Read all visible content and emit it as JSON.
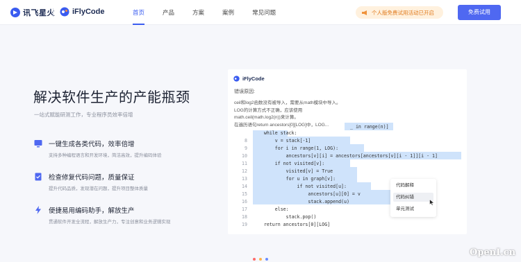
{
  "header": {
    "brand_name": "讯飞星火",
    "product_name": "iFlyCode",
    "nav": [
      "首页",
      "产品",
      "方案",
      "案例",
      "常见问题"
    ],
    "active_nav": "首页",
    "promo_text": "个人版免费试用活动已开启",
    "trial_button": "免费试用",
    "brand_color": "#4f68f1"
  },
  "hero": {
    "title": "解决软件生产的产能瓶颈",
    "subtitle": "一站式赋能研测工作，专业程序员效率倍增",
    "features": [
      {
        "icon": "monitor-icon",
        "title": "一键生成各类代码，效率倍增",
        "desc": "支持多种编程语言和开发环境，简洁高效，提升编码体验"
      },
      {
        "icon": "document-check-icon",
        "title": "检查修复代码问题，质量保证",
        "desc": "提升代码品质，发现潜在问题，提升项目整体质量"
      },
      {
        "icon": "lightning-icon",
        "title": "便捷易用编码助手，解放生产",
        "desc": "贯通软件开发全流程，解放生产力，专注创意和业务逻辑实现"
      }
    ]
  },
  "panel": {
    "brand": "iFlyCode",
    "error_title": "错误原因:",
    "error_lines": [
      "ceil和log2函数没有被导入，需要从math模块中导入。",
      "LOG的计算方式不正确，应该使用",
      "math.ceil(math.log2(n))来计算。",
      "在遍历语句return ancestors[0][LOG]中，LOG..."
    ],
    "hidden_fragment": "_ in range(n)]",
    "code_lines": [
      {
        "n": "",
        "text": "    while stack:"
      },
      {
        "n": "8",
        "text": "        v = stack[-1]"
      },
      {
        "n": "9",
        "text": "        for i in range(1, LOG):"
      },
      {
        "n": "10",
        "text": "            ancestors[v][i] = ancestors[ancestors[v][i - 1]][i - 1]"
      },
      {
        "n": "11",
        "text": "        if not visited[v]:"
      },
      {
        "n": "12",
        "text": "            visited[v] = True"
      },
      {
        "n": "13",
        "text": "            for u in graph[v]:"
      },
      {
        "n": "14",
        "text": "                if not visited[u]:"
      },
      {
        "n": "15",
        "text": "                    ancestors[u][0] = v"
      },
      {
        "n": "16",
        "text": "                    stack.append(u)"
      },
      {
        "n": "17",
        "text": "        else:"
      },
      {
        "n": "18",
        "text": "            stack.pop()"
      },
      {
        "n": "19",
        "text": "    return ancestors[0][LOG]"
      }
    ],
    "context_menu": [
      "代码解释",
      "代码纠错",
      "单元测试"
    ],
    "context_selected": "代码纠错"
  },
  "watermark": "OpenI.cn"
}
